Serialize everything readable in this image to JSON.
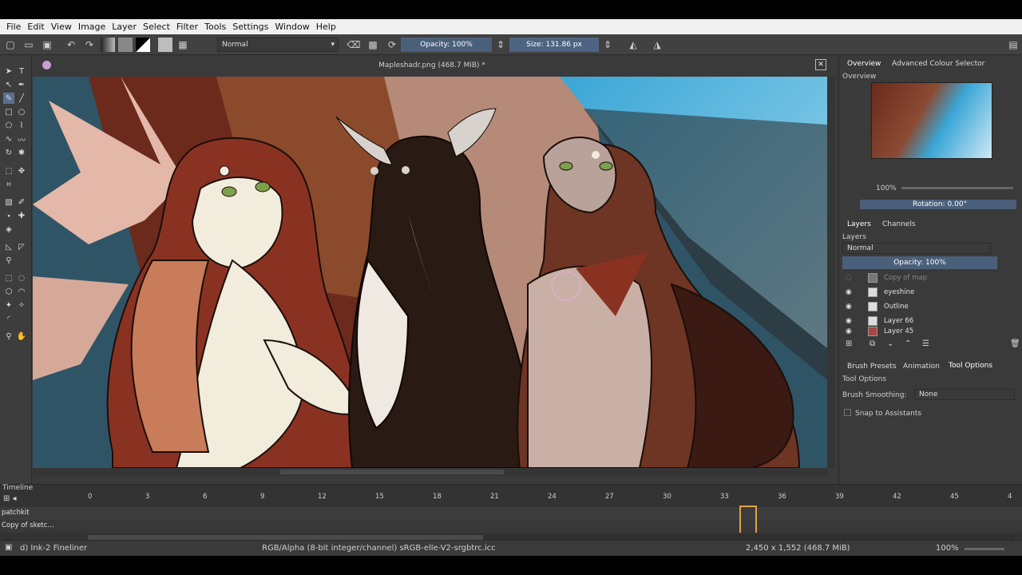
{
  "menu": [
    "File",
    "Edit",
    "View",
    "Image",
    "Layer",
    "Select",
    "Filter",
    "Tools",
    "Settings",
    "Window",
    "Help"
  ],
  "toolbar": {
    "blend_mode": "Normal",
    "opacity": "Opacity: 100%",
    "size": "Size: 131.86 px"
  },
  "document": {
    "title": "Mapleshadr.png (468.7 MiB) *"
  },
  "dock": {
    "tabs_top": [
      "Overview",
      "Advanced Colour Selector"
    ],
    "overview_label": "Overview",
    "zoom": "100%",
    "rotation": "Rotation: 0.00°",
    "layer_tabs": [
      "Layers",
      "Channels"
    ],
    "layers_label": "Layers",
    "layer_blend": "Normal",
    "layer_opacity": "Opacity:  100%",
    "layers": [
      {
        "name": "Copy of map",
        "visible": false
      },
      {
        "name": "eyeshine",
        "visible": true
      },
      {
        "name": "Outline",
        "visible": true
      },
      {
        "name": "Layer 66",
        "visible": true
      },
      {
        "name": "Layer 45",
        "visible": true
      }
    ],
    "bottom_tabs": [
      "Brush Presets",
      "Animation",
      "Tool Options"
    ],
    "tool_options_label": "Tool Options",
    "brush_smoothing_label": "Brush Smoothing:",
    "brush_smoothing_value": "None",
    "snap_label": "Snap to Assistants"
  },
  "timeline": {
    "label": "Timeline",
    "frames": [
      "0",
      "3",
      "6",
      "9",
      "12",
      "15",
      "18",
      "21",
      "24",
      "27",
      "30",
      "33",
      "36",
      "39",
      "42",
      "45",
      "4"
    ],
    "tracks": [
      "patchkit",
      "Copy of sketc..."
    ]
  },
  "status": {
    "brush": "d) Ink-2 Fineliner",
    "color_space": "RGB/Alpha (8-bit integer/channel)  sRGB-elle-V2-srgbtrc.icc",
    "dimensions": "2,450 x 1,552 (468.7 MiB)",
    "zoom": "100%"
  },
  "colors": {
    "accent": "#4a5f7a",
    "panel": "#3a3a3a",
    "canvas_sky": "#4fb8e0",
    "fur_red": "#8a3222",
    "fur_dark": "#2a1a14",
    "cream": "#f2ecdc"
  }
}
